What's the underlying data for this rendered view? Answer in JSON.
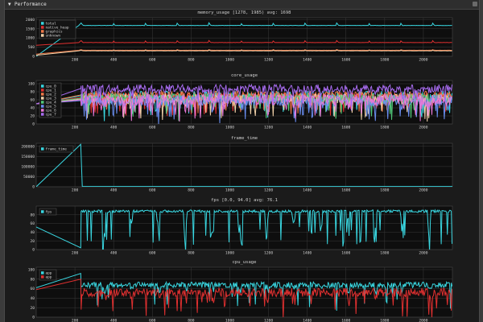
{
  "window": {
    "title": "Performance",
    "collapse_glyph": "▼"
  },
  "colors": {
    "background": "#1b1b1b",
    "plot_background": "#0e0e0e",
    "grid": "#3a3a3a",
    "text": "#cfcfcf"
  },
  "chart_data": [
    {
      "type": "line",
      "title": "memory_usage [1278, 1985) avg: 1698",
      "xlim": [
        0,
        2150
      ],
      "x_ticks": [
        200,
        400,
        600,
        800,
        1000,
        1200,
        1400,
        1600,
        1800,
        2000
      ],
      "ylim": [
        0,
        2100
      ],
      "y_ticks": [
        0,
        500,
        1000,
        1500,
        2000
      ],
      "y_tick_labels": [
        "0",
        "500",
        "1000",
        "1500",
        "2000"
      ],
      "legend": "top-left",
      "series": [
        {
          "name": "total",
          "color": "#39d6e0",
          "start": 0,
          "ramp_to": 220,
          "base": 1680,
          "spike": 140,
          "period": 165,
          "noise": 10
        },
        {
          "name": "native_heap",
          "color": "#e03030",
          "start": 600,
          "ramp_to": 220,
          "base": 750,
          "spike": 110,
          "period": 165,
          "noise": 10
        },
        {
          "name": "graphics",
          "color": "#f07848",
          "start": 120,
          "ramp_to": 220,
          "base": 330,
          "spike": 40,
          "period": 165,
          "noise": 8
        },
        {
          "name": "unknown",
          "color": "#f0d0a8",
          "start": 60,
          "ramp_to": 220,
          "base": 300,
          "spike": 30,
          "period": 165,
          "noise": 5
        }
      ]
    },
    {
      "type": "line",
      "title": "core_usage",
      "xlim": [
        0,
        2150
      ],
      "x_ticks": [
        200,
        400,
        600,
        800,
        1000,
        1200,
        1400,
        1600,
        1800,
        2000
      ],
      "ylim": [
        0,
        108
      ],
      "y_ticks": [
        0,
        20,
        40,
        60,
        80,
        100
      ],
      "y_tick_labels": [
        "0",
        "20",
        "40",
        "60",
        "80",
        "100"
      ],
      "legend": "top-left",
      "series": [
        {
          "name": "cpu_0",
          "color": "#39d6e0",
          "start": 50,
          "base": 70,
          "noise": 12,
          "period": 140
        },
        {
          "name": "cpu_1",
          "color": "#e03030",
          "start": 50,
          "base": 66,
          "noise": 12,
          "period": 140
        },
        {
          "name": "cpu_2",
          "color": "#f07848",
          "start": 50,
          "base": 72,
          "noise": 10,
          "period": 140
        },
        {
          "name": "cpu_3",
          "color": "#f0d0a8",
          "start": 50,
          "base": 62,
          "noise": 12,
          "period": 140
        },
        {
          "name": "cpu_4",
          "color": "#50c878",
          "start": 50,
          "base": 64,
          "noise": 12,
          "period": 140
        },
        {
          "name": "cpu_5",
          "color": "#6a8ef0",
          "start": 50,
          "base": 58,
          "noise": 14,
          "period": 140
        },
        {
          "name": "cpu_6",
          "color": "#e878d8",
          "start": 50,
          "base": 60,
          "noise": 14,
          "period": 140
        },
        {
          "name": "cpu_7",
          "color": "#a86cf0",
          "start": 50,
          "base": 88,
          "noise": 10,
          "period": 140
        }
      ]
    },
    {
      "type": "line",
      "title": "frame_time",
      "xlim": [
        0,
        2150
      ],
      "x_ticks": [
        200,
        400,
        600,
        800,
        1000,
        1200,
        1400,
        1600,
        1800,
        2000
      ],
      "ylim": [
        0,
        215000
      ],
      "y_ticks": [
        0,
        50000,
        100000,
        150000,
        200000
      ],
      "y_tick_labels": [
        "0",
        "50000",
        "100000",
        "150000",
        "200000"
      ],
      "legend": "top-left",
      "series": [
        {
          "name": "frame_time",
          "color": "#39d6e0",
          "points": [
            [
              0,
              0
            ],
            [
              230,
              210000
            ],
            [
              238,
              1500
            ],
            [
              2150,
              1500
            ]
          ]
        }
      ]
    },
    {
      "type": "line",
      "title": "fps [0.0, 94.0] avg: 76.1",
      "xlim": [
        0,
        2150
      ],
      "x_ticks": [
        200,
        400,
        600,
        800,
        1000,
        1200,
        1400,
        1600,
        1800,
        2000
      ],
      "ylim": [
        0,
        100
      ],
      "y_ticks": [
        0,
        20,
        40,
        60,
        80
      ],
      "y_tick_labels": [
        "0",
        "20",
        "40",
        "60",
        "80"
      ],
      "legend": "top-left",
      "series": [
        {
          "name": "fps",
          "color": "#39d6e0",
          "start_line": [
            [
              0,
              52
            ],
            [
              230,
              4
            ]
          ],
          "base": 88,
          "dip": 12,
          "period": 140,
          "noise": 3
        }
      ]
    },
    {
      "type": "line",
      "title": "cpu_usage",
      "xlim": [
        0,
        2150
      ],
      "x_ticks": [
        200,
        400,
        600,
        800,
        1000,
        1200,
        1400,
        1600,
        1800,
        2000
      ],
      "ylim": [
        0,
        105
      ],
      "y_ticks": [
        0,
        20,
        40,
        60,
        80,
        100
      ],
      "y_tick_labels": [
        "0",
        "20",
        "40",
        "60",
        "80",
        "100"
      ],
      "legend": "top-left",
      "series": [
        {
          "name": "app",
          "color": "#39d6e0",
          "start_line": [
            [
              0,
              62
            ],
            [
              230,
              92
            ]
          ],
          "base": 68,
          "noise": 6,
          "period": 140
        },
        {
          "name": "app",
          "color": "#e03030",
          "start_line": [
            [
              0,
              58
            ],
            [
              230,
              80
            ]
          ],
          "base": 52,
          "noise": 9,
          "period": 140
        }
      ]
    }
  ]
}
